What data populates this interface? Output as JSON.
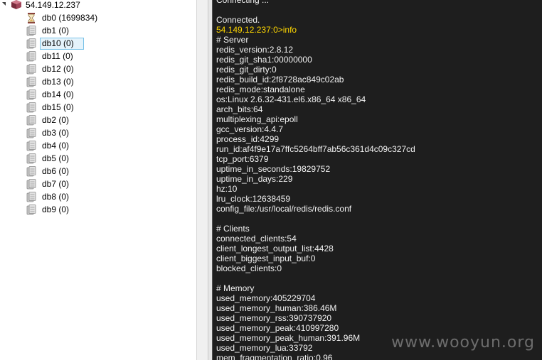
{
  "tree": {
    "root_label": "54.149.12.237",
    "databases": [
      {
        "label": "db0 (1699834)",
        "icon": "hourglass-icon",
        "selected": false
      },
      {
        "label": "db1 (0)",
        "icon": "database-icon",
        "selected": false
      },
      {
        "label": "db10 (0)",
        "icon": "database-icon",
        "selected": true
      },
      {
        "label": "db11 (0)",
        "icon": "database-icon",
        "selected": false
      },
      {
        "label": "db12 (0)",
        "icon": "database-icon",
        "selected": false
      },
      {
        "label": "db13 (0)",
        "icon": "database-icon",
        "selected": false
      },
      {
        "label": "db14 (0)",
        "icon": "database-icon",
        "selected": false
      },
      {
        "label": "db15 (0)",
        "icon": "database-icon",
        "selected": false
      },
      {
        "label": "db2 (0)",
        "icon": "database-icon",
        "selected": false
      },
      {
        "label": "db3 (0)",
        "icon": "database-icon",
        "selected": false
      },
      {
        "label": "db4 (0)",
        "icon": "database-icon",
        "selected": false
      },
      {
        "label": "db5 (0)",
        "icon": "database-icon",
        "selected": false
      },
      {
        "label": "db6 (0)",
        "icon": "database-icon",
        "selected": false
      },
      {
        "label": "db7 (0)",
        "icon": "database-icon",
        "selected": false
      },
      {
        "label": "db8 (0)",
        "icon": "database-icon",
        "selected": false
      },
      {
        "label": "db9 (0)",
        "icon": "database-icon",
        "selected": false
      }
    ]
  },
  "console": {
    "lines": [
      {
        "text": "Connecting ...",
        "prompt": false
      },
      {
        "text": "",
        "prompt": false
      },
      {
        "text": "Connected.",
        "prompt": false
      },
      {
        "text": "54.149.12.237:0>info",
        "prompt": true
      },
      {
        "text": "# Server",
        "prompt": false
      },
      {
        "text": "redis_version:2.8.12",
        "prompt": false
      },
      {
        "text": "redis_git_sha1:00000000",
        "prompt": false
      },
      {
        "text": "redis_git_dirty:0",
        "prompt": false
      },
      {
        "text": "redis_build_id:2f8728ac849c02ab",
        "prompt": false
      },
      {
        "text": "redis_mode:standalone",
        "prompt": false
      },
      {
        "text": "os:Linux 2.6.32-431.el6.x86_64 x86_64",
        "prompt": false
      },
      {
        "text": "arch_bits:64",
        "prompt": false
      },
      {
        "text": "multiplexing_api:epoll",
        "prompt": false
      },
      {
        "text": "gcc_version:4.4.7",
        "prompt": false
      },
      {
        "text": "process_id:4299",
        "prompt": false
      },
      {
        "text": "run_id:af4f9e17a7ffc5264bff7ab56c361d4c09c327cd",
        "prompt": false
      },
      {
        "text": "tcp_port:6379",
        "prompt": false
      },
      {
        "text": "uptime_in_seconds:19829752",
        "prompt": false
      },
      {
        "text": "uptime_in_days:229",
        "prompt": false
      },
      {
        "text": "hz:10",
        "prompt": false
      },
      {
        "text": "lru_clock:12638459",
        "prompt": false
      },
      {
        "text": "config_file:/usr/local/redis/redis.conf",
        "prompt": false
      },
      {
        "text": "",
        "prompt": false
      },
      {
        "text": "# Clients",
        "prompt": false
      },
      {
        "text": "connected_clients:54",
        "prompt": false
      },
      {
        "text": "client_longest_output_list:4428",
        "prompt": false
      },
      {
        "text": "client_biggest_input_buf:0",
        "prompt": false
      },
      {
        "text": "blocked_clients:0",
        "prompt": false
      },
      {
        "text": "",
        "prompt": false
      },
      {
        "text": "# Memory",
        "prompt": false
      },
      {
        "text": "used_memory:405229704",
        "prompt": false
      },
      {
        "text": "used_memory_human:386.46M",
        "prompt": false
      },
      {
        "text": "used_memory_rss:390737920",
        "prompt": false
      },
      {
        "text": "used_memory_peak:410997280",
        "prompt": false
      },
      {
        "text": "used_memory_peak_human:391.96M",
        "prompt": false
      },
      {
        "text": "used_memory_lua:33792",
        "prompt": false
      },
      {
        "text": "mem_fragmentation_ratio:0.96",
        "prompt": false
      }
    ]
  },
  "watermark": "www.wooyun.org",
  "colors": {
    "console_bg": "#1e1e1e",
    "console_text": "#f2f2f2",
    "prompt_text": "#ffd700",
    "selection_bg": "#e5f3fb",
    "selection_border": "#7bc3e8"
  }
}
